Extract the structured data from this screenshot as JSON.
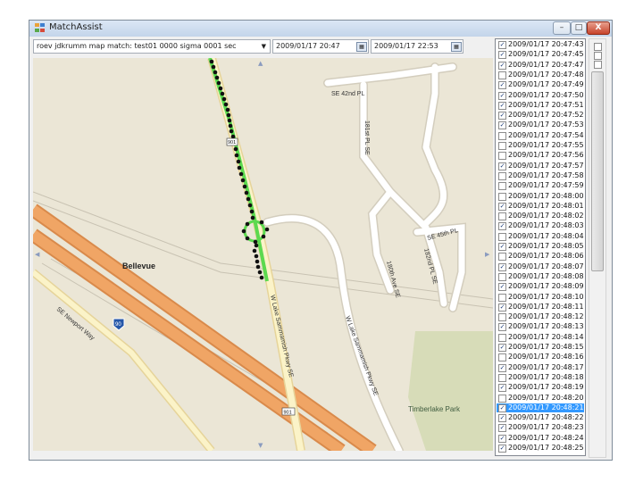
{
  "window": {
    "title": "MatchAssist",
    "minimize": "–",
    "maximize": "□",
    "close": "X"
  },
  "toolbar": {
    "query": "roev jdkrumm map match: test01 0000 sigma 0001 sec",
    "start_time": "2009/01/17 20:47",
    "end_time": "2009/01/17 22:53"
  },
  "map": {
    "labels": {
      "bellevue": "Bellevue",
      "se_42nd": "SE 42nd PL",
      "st_181": "181st PL SE",
      "se_45th": "SE 45th PL",
      "ave_180": "180th Ave SE",
      "pl_182": "182nd PL SE",
      "se_newport": "SE Newport Way",
      "w_lake_1": "W Lake Sammamish Pkwy SE",
      "w_lake_2": "W Lake Sammamish Pkwy SE",
      "park": "Timberlake Park",
      "shield_90": "90",
      "shield_901a": "901",
      "shield_901b": "901"
    }
  },
  "timestamps": {
    "items": [
      {
        "label": "2009/01/17 20:47:43",
        "checked": true,
        "selected": false
      },
      {
        "label": "2009/01/17 20:47:45",
        "checked": true,
        "selected": false
      },
      {
        "label": "2009/01/17 20:47:47",
        "checked": true,
        "selected": false
      },
      {
        "label": "2009/01/17 20:47:48",
        "checked": false,
        "selected": false
      },
      {
        "label": "2009/01/17 20:47:49",
        "checked": true,
        "selected": false
      },
      {
        "label": "2009/01/17 20:47:50",
        "checked": true,
        "selected": false
      },
      {
        "label": "2009/01/17 20:47:51",
        "checked": true,
        "selected": false
      },
      {
        "label": "2009/01/17 20:47:52",
        "checked": true,
        "selected": false
      },
      {
        "label": "2009/01/17 20:47:53",
        "checked": true,
        "selected": false
      },
      {
        "label": "2009/01/17 20:47:54",
        "checked": false,
        "selected": false
      },
      {
        "label": "2009/01/17 20:47:55",
        "checked": false,
        "selected": false
      },
      {
        "label": "2009/01/17 20:47:56",
        "checked": false,
        "selected": false
      },
      {
        "label": "2009/01/17 20:47:57",
        "checked": true,
        "selected": false
      },
      {
        "label": "2009/01/17 20:47:58",
        "checked": false,
        "selected": false
      },
      {
        "label": "2009/01/17 20:47:59",
        "checked": false,
        "selected": false
      },
      {
        "label": "2009/01/17 20:48:00",
        "checked": false,
        "selected": false
      },
      {
        "label": "2009/01/17 20:48:01",
        "checked": true,
        "selected": false
      },
      {
        "label": "2009/01/17 20:48:02",
        "checked": false,
        "selected": false
      },
      {
        "label": "2009/01/17 20:48:03",
        "checked": true,
        "selected": false
      },
      {
        "label": "2009/01/17 20:48:04",
        "checked": false,
        "selected": false
      },
      {
        "label": "2009/01/17 20:48:05",
        "checked": true,
        "selected": false
      },
      {
        "label": "2009/01/17 20:48:06",
        "checked": false,
        "selected": false
      },
      {
        "label": "2009/01/17 20:48:07",
        "checked": true,
        "selected": false
      },
      {
        "label": "2009/01/17 20:48:08",
        "checked": false,
        "selected": false
      },
      {
        "label": "2009/01/17 20:48:09",
        "checked": true,
        "selected": false
      },
      {
        "label": "2009/01/17 20:48:10",
        "checked": false,
        "selected": false
      },
      {
        "label": "2009/01/17 20:48:11",
        "checked": true,
        "selected": false
      },
      {
        "label": "2009/01/17 20:48:12",
        "checked": false,
        "selected": false
      },
      {
        "label": "2009/01/17 20:48:13",
        "checked": true,
        "selected": false
      },
      {
        "label": "2009/01/17 20:48:14",
        "checked": false,
        "selected": false
      },
      {
        "label": "2009/01/17 20:48:15",
        "checked": true,
        "selected": false
      },
      {
        "label": "2009/01/17 20:48:16",
        "checked": false,
        "selected": false
      },
      {
        "label": "2009/01/17 20:48:17",
        "checked": true,
        "selected": false
      },
      {
        "label": "2009/01/17 20:48:18",
        "checked": false,
        "selected": false
      },
      {
        "label": "2009/01/17 20:48:19",
        "checked": true,
        "selected": false
      },
      {
        "label": "2009/01/17 20:48:20",
        "checked": false,
        "selected": false
      },
      {
        "label": "2009/01/17 20:48:21",
        "checked": true,
        "selected": true
      },
      {
        "label": "2009/01/17 20:48:22",
        "checked": true,
        "selected": false
      },
      {
        "label": "2009/01/17 20:48:23",
        "checked": true,
        "selected": false
      },
      {
        "label": "2009/01/17 20:48:24",
        "checked": true,
        "selected": false
      },
      {
        "label": "2009/01/17 20:48:25",
        "checked": true,
        "selected": false
      }
    ]
  },
  "colors": {
    "map_background": "#ebe6d6",
    "freeway": "#f0a565",
    "road": "#ffffff",
    "route": "#5cd94f",
    "gps_point": "#111111",
    "park": "#d7dcb8",
    "selection": "#3399ff"
  }
}
